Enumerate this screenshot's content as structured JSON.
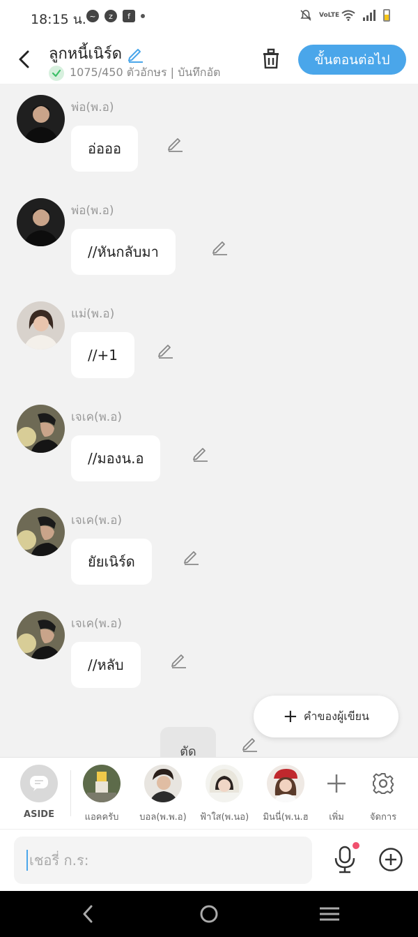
{
  "status_bar": {
    "time": "18:15 น.",
    "left_icons": [
      "messenger-icon",
      "zalo-icon",
      "facebook-icon"
    ],
    "right_icons": [
      "mute-icon",
      "volte-icon",
      "wifi-icon",
      "signal-icon",
      "battery-icon"
    ],
    "volte_label": "VoLTE"
  },
  "header": {
    "title": "ลูกหนี้เนิร์ด",
    "subtitle": "1075/450 ตัวอักษร | บันทึกอัต",
    "next_button": "ขั้นตอนต่อไป"
  },
  "messages": [
    {
      "sender": "พ่อ(พ.อ)",
      "text": "อ่อออ"
    },
    {
      "sender": "พ่อ(พ.อ)",
      "text": "//หันกลับมา"
    },
    {
      "sender": "แม่(พ.อ)",
      "text": "//+1"
    },
    {
      "sender": "เจเค(พ.อ)",
      "text": "//มองน.อ"
    },
    {
      "sender": "เจเค(พ.อ)",
      "text": "ยัยเนิร์ด"
    },
    {
      "sender": "เจเค(พ.อ)",
      "text": "//หลับ"
    }
  ],
  "cut_bubble": "ตัด",
  "author_words_button": "คำของผู้เขียน",
  "characters": [
    {
      "name": "ASIDE"
    },
    {
      "name": "แอคครับ"
    },
    {
      "name": "บอล(พ.พ.อ)"
    },
    {
      "name": "ฟ้าใส(พ.นอ)"
    },
    {
      "name": "มินนี่(พ.น.ฮ"
    }
  ],
  "char_actions": {
    "add": "เพิ่ม",
    "manage": "จัดการ"
  },
  "input": {
    "placeholder": "เชอรี่ ก.ร:"
  },
  "colors": {
    "accent": "#4aa6ea",
    "check_green": "#3bbf66",
    "notif_dot": "#f0506e"
  }
}
